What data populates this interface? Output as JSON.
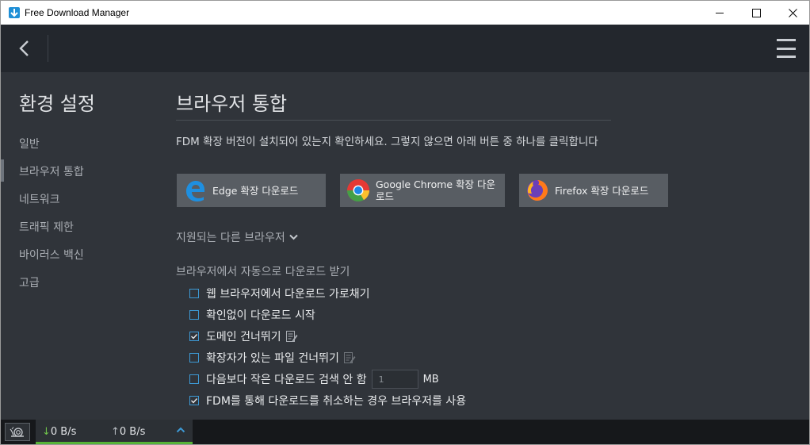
{
  "window": {
    "title": "Free Download Manager",
    "buttons": [
      "minimize-icon",
      "maximize-icon",
      "close-icon"
    ]
  },
  "toolbar": {
    "back_icon": "chevron-left-icon",
    "menu_icon": "hamburger-menu-icon"
  },
  "sidebar": {
    "title": "환경 설정",
    "active_index": 1,
    "items": [
      {
        "label": "일반"
      },
      {
        "label": "브라우저 통합"
      },
      {
        "label": "네트워크"
      },
      {
        "label": "트래픽 제한"
      },
      {
        "label": "바이러스 백신"
      },
      {
        "label": "고급"
      }
    ]
  },
  "section": {
    "title": "브라우저 통합",
    "info": "FDM 확장 버전이 설치되어 있는지 확인하세요. 그렇지 않으면 아래 버튼 중 하나를 클릭합니다",
    "buttons": [
      {
        "label": "Edge 확장 다운로드",
        "icon": "edge-logo-icon"
      },
      {
        "label": "Google Chrome 확장 다운로드",
        "icon": "chrome-logo-icon"
      },
      {
        "label": "Firefox 확장 다운로드",
        "icon": "firefox-logo-icon"
      }
    ],
    "other_browsers": "지원되는 다른 브라우저",
    "auto_title": "브라우저에서 자동으로 다운로드 받기",
    "options": [
      {
        "label": "웹 브라우저에서 다운로드 가로채기",
        "checked": false
      },
      {
        "label": "확인없이 다운로드 시작",
        "checked": false
      },
      {
        "label": "도메인 건너뛰기",
        "checked": true,
        "icon": "edit-list-icon"
      },
      {
        "label": "확장자가 있는 파일 건너뛰기",
        "checked": false,
        "icon": "edit-list-icon"
      },
      {
        "label": "다음보다 작은 다운로드 검색 안 함",
        "checked": false,
        "input_value": "1",
        "unit": "MB"
      },
      {
        "label": "FDM를 통해 다운로드를 취소하는 경우 브라우저를 사용",
        "checked": true
      }
    ]
  },
  "statusbar": {
    "snail_icon": "snail-icon",
    "download_speed": "0 B/s",
    "upload_speed": "0 B/s",
    "expand_icon": "chevron-up-icon"
  },
  "colors": {
    "accent": "#3d9ad6",
    "speed_bar": "#57b337",
    "background": "#30343a",
    "toolbar": "#23272d"
  }
}
